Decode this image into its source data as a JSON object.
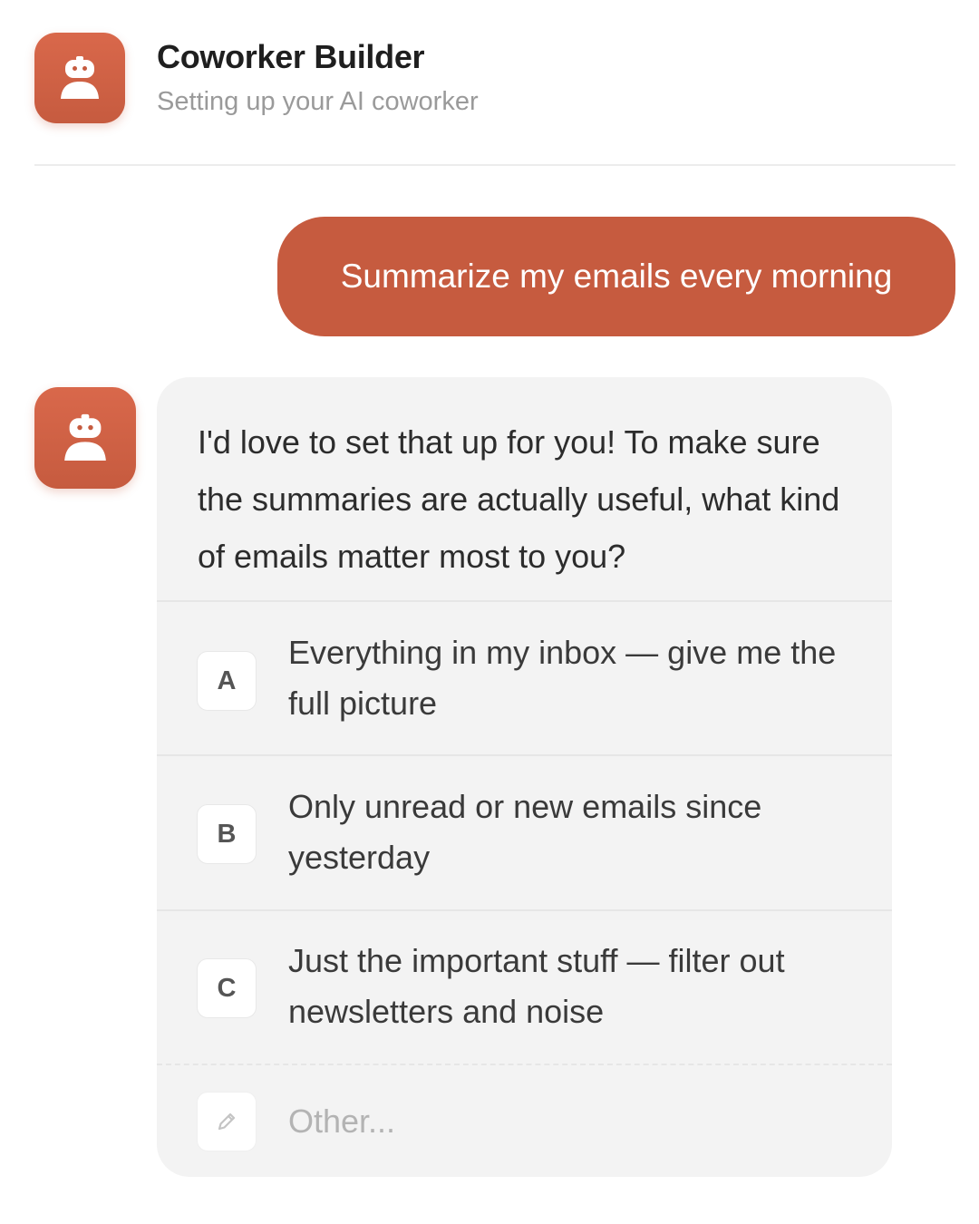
{
  "header": {
    "title": "Coworker Builder",
    "subtitle": "Setting up your AI coworker",
    "avatar_icon": "robot-icon"
  },
  "user_message": {
    "text": "Summarize my emails every morning"
  },
  "bot_message": {
    "avatar_icon": "robot-icon",
    "question": "I'd love to set that up for you! To make sure the summaries are actually useful, what kind of emails matter most to you?",
    "options": [
      {
        "letter": "A",
        "text": "Everything in my inbox — give me the full picture"
      },
      {
        "letter": "B",
        "text": "Only unread or new emails since yesterday"
      },
      {
        "letter": "C",
        "text": "Just the important stuff — filter out newsletters and noise"
      }
    ],
    "other": {
      "icon": "pencil-icon",
      "placeholder": "Other..."
    }
  },
  "colors": {
    "accent": "#c65b3f",
    "card_background": "#f3f3f3",
    "muted_text": "#9a9a9a"
  }
}
